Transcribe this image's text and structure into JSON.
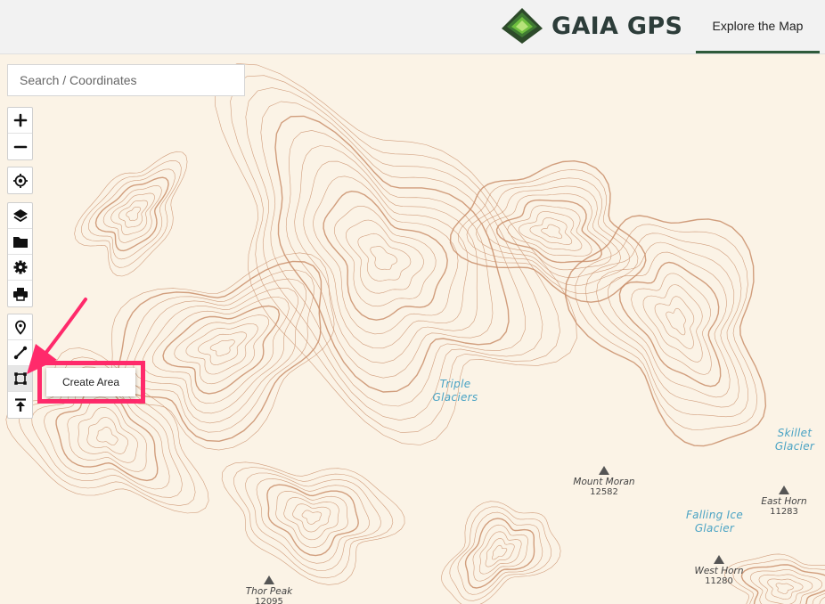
{
  "header": {
    "brand": "GAIA GPS",
    "nav_tab": "Explore the Map",
    "colors": {
      "brand_dark": "#2d3d3a",
      "brand_green": "#4f9a3a",
      "tab_underline": "#2e5a3a"
    }
  },
  "search": {
    "placeholder": "Search / Coordinates",
    "value": ""
  },
  "toolbar": {
    "zoom_in_icon": "plus-icon",
    "zoom_out_icon": "minus-icon",
    "locate_icon": "crosshair-icon",
    "layers_icon": "layers-icon",
    "folder_icon": "folder-icon",
    "settings_icon": "gear-icon",
    "print_icon": "printer-icon",
    "waypoint_icon": "map-pin-icon",
    "route_icon": "route-icon",
    "area_icon": "polygon-icon",
    "import_icon": "upload-icon"
  },
  "tooltip": {
    "label": "Create Area",
    "highlight_color": "#ff2a6b"
  },
  "map": {
    "colors": {
      "background": "#fbf3e6",
      "contour": "#c98e6a",
      "water_label": "#4aa3c4"
    },
    "labels": {
      "triple_glaciers": [
        "Triple",
        "Glaciers"
      ],
      "skillet_glacier": [
        "Skillet",
        "Glacier"
      ],
      "falling_ice_glacier": [
        "Falling Ice",
        "Glacier"
      ]
    },
    "peaks": {
      "mount_moran": {
        "name": "Mount Moran",
        "elevation": "12582"
      },
      "east_horn": {
        "name": "East Horn",
        "elevation": "11283"
      },
      "west_horn": {
        "name": "West Horn",
        "elevation": "11280"
      },
      "thor_peak": {
        "name": "Thor Peak",
        "elevation": "12095"
      }
    }
  }
}
